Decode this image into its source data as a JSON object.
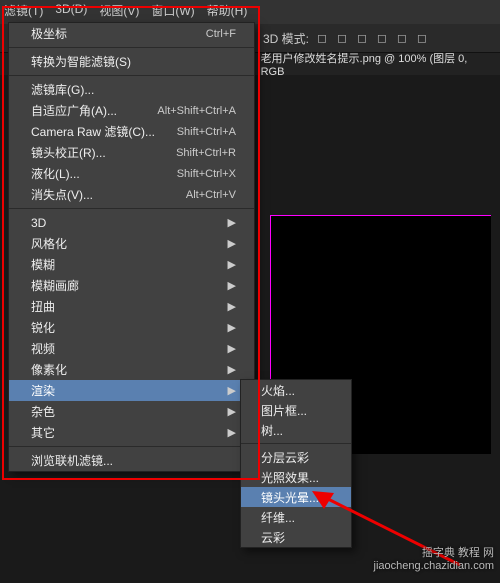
{
  "menubar": [
    "滤镜(T)",
    "3D(D)",
    "视图(V)",
    "窗口(W)",
    "帮助(H)"
  ],
  "toolbar": {
    "mode_label": "3D 模式:",
    "icons": [
      "square-icon",
      "circle-icon",
      "cloud-icon",
      "arrows-icon",
      "grid-icon",
      "page-icon"
    ]
  },
  "tab": {
    "title": "老用户修改姓名提示.png @ 100% (图层 0, RGB"
  },
  "filter_menu": {
    "items": [
      {
        "label": "极坐标",
        "shortcut": "Ctrl+F"
      },
      {
        "sep": true
      },
      {
        "label": "转换为智能滤镜(S)"
      },
      {
        "sep": true
      },
      {
        "label": "滤镜库(G)..."
      },
      {
        "label": "自适应广角(A)...",
        "shortcut": "Alt+Shift+Ctrl+A"
      },
      {
        "label": "Camera Raw 滤镜(C)...",
        "shortcut": "Shift+Ctrl+A"
      },
      {
        "label": "镜头校正(R)...",
        "shortcut": "Shift+Ctrl+R"
      },
      {
        "label": "液化(L)...",
        "shortcut": "Shift+Ctrl+X"
      },
      {
        "label": "消失点(V)...",
        "shortcut": "Alt+Ctrl+V"
      },
      {
        "sep": true
      },
      {
        "label": "3D",
        "arrow": true
      },
      {
        "label": "风格化",
        "arrow": true
      },
      {
        "label": "模糊",
        "arrow": true
      },
      {
        "label": "模糊画廊",
        "arrow": true
      },
      {
        "label": "扭曲",
        "arrow": true
      },
      {
        "label": "锐化",
        "arrow": true
      },
      {
        "label": "视频",
        "arrow": true
      },
      {
        "label": "像素化",
        "arrow": true
      },
      {
        "label": "渲染",
        "arrow": true,
        "hover": true,
        "name": "render"
      },
      {
        "label": "杂色",
        "arrow": true
      },
      {
        "label": "其它",
        "arrow": true
      },
      {
        "sep": true
      },
      {
        "label": "浏览联机滤镜..."
      }
    ]
  },
  "render_submenu": {
    "items": [
      {
        "label": "火焰..."
      },
      {
        "label": "图片框..."
      },
      {
        "label": "树..."
      },
      {
        "sep": true
      },
      {
        "label": "分层云彩"
      },
      {
        "label": "光照效果..."
      },
      {
        "label": "镜头光晕...",
        "hover": true,
        "name": "lens-flare"
      },
      {
        "label": "纤维..."
      },
      {
        "label": "云彩"
      }
    ]
  },
  "watermark": {
    "l1": "摇字典 教程 网",
    "l2": "jiaocheng.chazidian.com"
  }
}
